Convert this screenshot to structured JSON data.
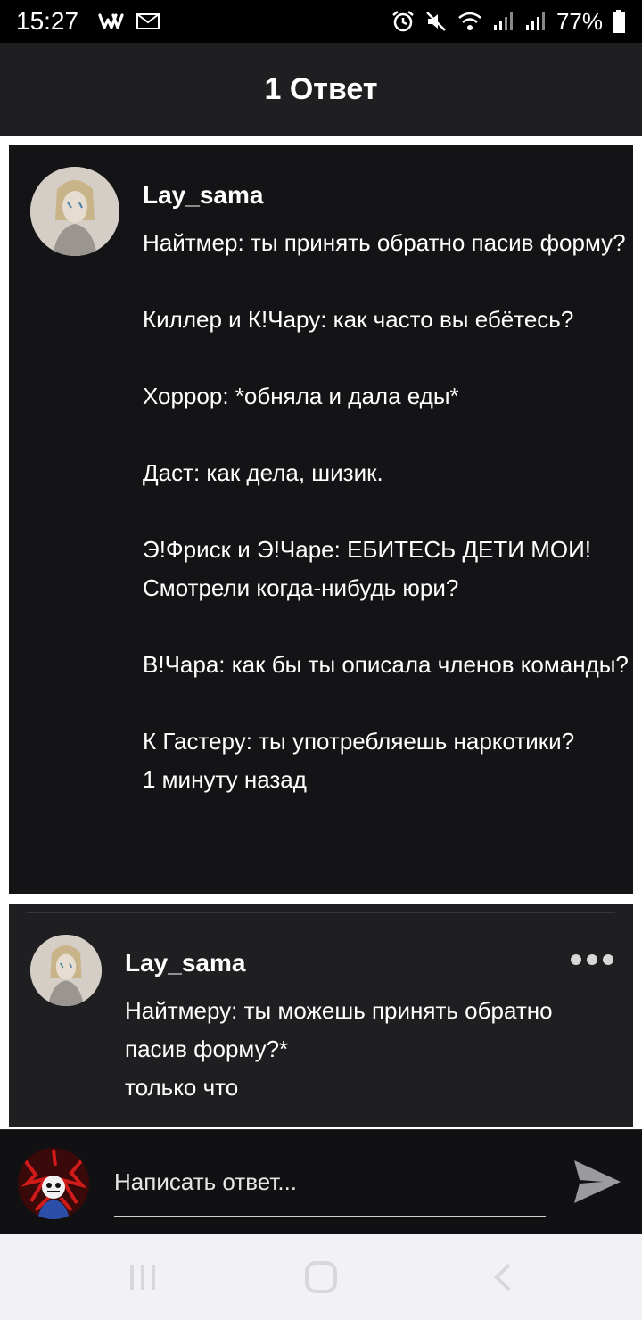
{
  "status_bar": {
    "time": "15:27",
    "battery": "77%",
    "icons": [
      "wattpad-icon",
      "gmail-icon",
      "alarm-icon",
      "mute-icon",
      "wifi-icon",
      "signal-icon",
      "signal-icon",
      "battery-icon"
    ]
  },
  "header": {
    "title": "1 Ответ"
  },
  "original_comment": {
    "username": "Lay_sama",
    "text": "Найтмер: ты принять обратно пасив форму?\n\nКиллер и К!Чару: как часто вы ебётесь?\n\nХоррор: *обняла и дала еды*\n\nДаст: как дела, шизик.\n\nЭ!Фриск и Э!Чаре: ЕБИТЕСЬ ДЕТИ МОИ! Смотрели когда-нибудь юри?\n\nВ!Чара: как бы ты описала членов команды?\n\nК Гастеру: ты употребляешь наркотики?",
    "time": "1 минуту назад"
  },
  "reply": {
    "username": "Lay_sama",
    "text": "Найтмеру: ты можешь принять обратно пасив форму?*",
    "time": "только что"
  },
  "composer": {
    "placeholder": "Написать ответ..."
  },
  "colors": {
    "background_card": "#141316",
    "header_bg": "#1f1f21",
    "reply_bg": "#1f1e21",
    "nav_bg": "#f2f2f4"
  }
}
